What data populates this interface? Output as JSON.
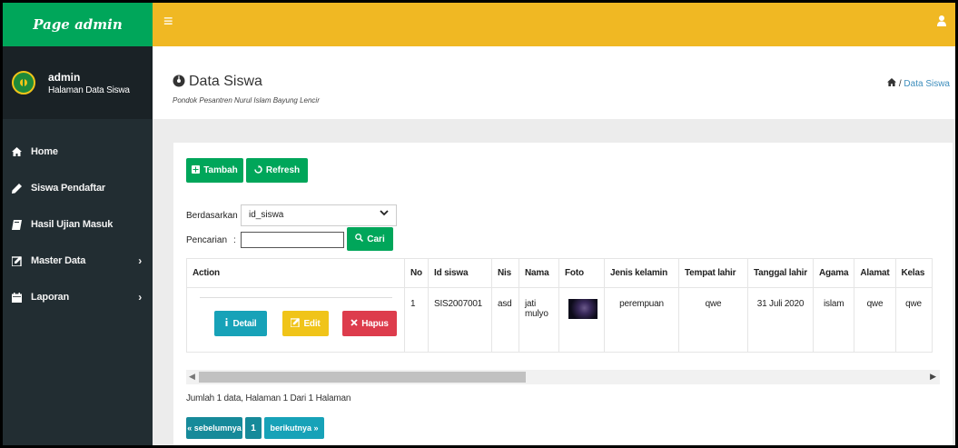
{
  "sidebar": {
    "brand": "Page admin",
    "user_name": "admin",
    "user_desc": "Halaman Data Siswa",
    "items": [
      {
        "label": "Home",
        "icon": "home-icon"
      },
      {
        "label": "Siswa Pendaftar",
        "icon": "pencil-icon"
      },
      {
        "label": "Hasil Ujian Masuk",
        "icon": "book-icon"
      },
      {
        "label": "Master Data",
        "icon": "edit-icon",
        "chevron": "›"
      },
      {
        "label": "Laporan",
        "icon": "calendar-icon",
        "chevron": "›"
      }
    ]
  },
  "header": {
    "menu_icon": "≡",
    "user_icon": "user-icon"
  },
  "content_header": {
    "title": "Data Siswa",
    "subtitle": "Pondok Pesantren Nurul Islam Bayung Lencir",
    "breadcrumb_home_icon": "home-icon",
    "breadcrumb_sep": "/",
    "breadcrumb_current": "Data Siswa"
  },
  "toolbar": {
    "add_label": "Tambah",
    "refresh_label": "Refresh"
  },
  "filter": {
    "by_label": "Berdasarkan :",
    "selected": "id_siswa",
    "search_label": "Pencarian",
    "search_colon": ":",
    "search_value": "",
    "search_button": "Cari"
  },
  "table": {
    "headers": [
      "Action",
      "No",
      "Id siswa",
      "Nis",
      "Nama",
      "Foto",
      "Jenis kelamin",
      "Tempat lahir",
      "Tanggal lahir",
      "Agama",
      "Alamat",
      "Kelas"
    ],
    "rows": [
      {
        "no": "1",
        "id_siswa": "SIS2007001",
        "nis": "asd",
        "nama": "jati mulyo",
        "jenis_kelamin": "perempuan",
        "tempat_lahir": "qwe",
        "tanggal_lahir": "31 Juli 2020",
        "agama": "islam",
        "alamat": "qwe",
        "kelas": "qwe"
      }
    ],
    "actions": {
      "detail": "Detail",
      "edit": "Edit",
      "hapus": "Hapus"
    }
  },
  "footer": {
    "summary": "Jumlah 1 data, Halaman 1 Dari 1 Halaman",
    "prev": "« sebelumnya",
    "page": "1",
    "next": "berikutnya »"
  },
  "colors": {
    "brand_green": "#00a65a",
    "topbar_yellow": "#f0b823",
    "sidebar_dark": "#222d32",
    "teal": "#17a2b8",
    "danger": "#dd3c4c"
  }
}
